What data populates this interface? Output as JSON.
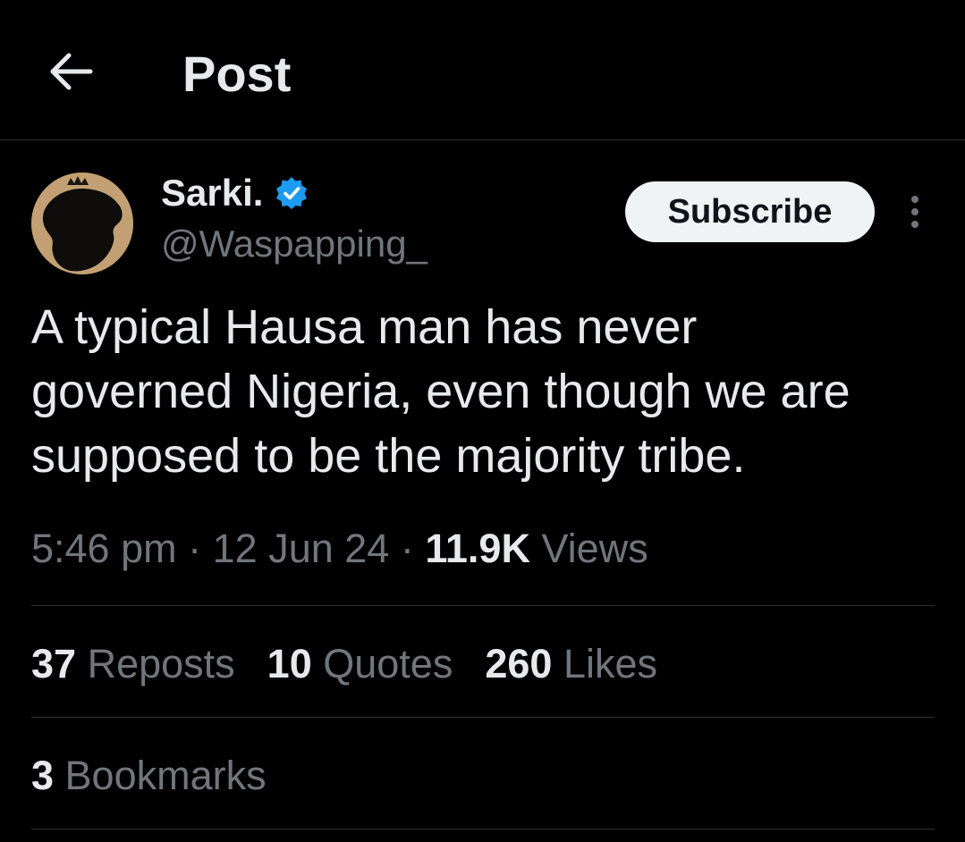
{
  "header": {
    "title": "Post",
    "back_icon": "arrow-left-icon"
  },
  "author": {
    "display_name": "Sarki.",
    "handle": "@Waspapping_",
    "verified_icon": "verified-badge-icon",
    "verified_color": "#1d9bf0"
  },
  "actions": {
    "subscribe_label": "Subscribe",
    "more_icon": "more-vertical-icon"
  },
  "post": {
    "text": "A typical Hausa man has never\ngoverned Nigeria, even though we are\nsupposed to be the majority tribe."
  },
  "meta": {
    "time": "5:46 pm",
    "separator": "·",
    "date": "12 Jun 24",
    "views_count": "11.9K",
    "views_label": "Views"
  },
  "stats": {
    "reposts_count": "37",
    "reposts_label": "Reposts",
    "quotes_count": "10",
    "quotes_label": "Quotes",
    "likes_count": "260",
    "likes_label": "Likes",
    "bookmarks_count": "3",
    "bookmarks_label": "Bookmarks"
  },
  "colors": {
    "background": "#000000",
    "text_primary": "#e7e9ea",
    "text_secondary": "#71767b",
    "divider": "#2f3336",
    "button_bg": "#eff3f4",
    "button_text": "#0f1419"
  }
}
